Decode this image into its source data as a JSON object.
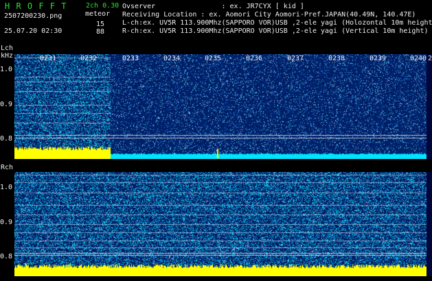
{
  "header": {
    "logo": "H R O F F T",
    "mode": "2ch 0.30",
    "file": "2507200230.png",
    "meteor_label": "meteor",
    "count_l": "15",
    "count_r": "88",
    "datetime": "25.07.20 02:30",
    "observer": "Ovserver                : ex. JR7CYX [ kid ]",
    "location": "Receiving Location : ex. Aomori City Aomori-Pref.JAPAN(40.49N, 140.47E)",
    "lch": "L-ch:ex. UV5R 113.900Mhz(SAPPORO VOR)USB ,2-ele yagi (Holozontal 10m height)",
    "rch": "R-ch:ex. UV5R 113.900Mhz(SAPPORO VOR)USB ,2-ele yagi (Vertical 10m height)"
  },
  "axis": {
    "lch_label": "Lch",
    "khz_label": "kHz",
    "rch_label": "Rch",
    "ticks": [
      "1.0",
      "0.9",
      "0.8"
    ]
  },
  "time_labels": [
    "0231",
    "0232",
    "0233",
    "0234",
    "0235",
    "0236",
    "0237",
    "0238",
    "0239",
    "0240",
    "2"
  ],
  "colors": {
    "green_text": "#2ee02e",
    "white_text": "#f0f0f0",
    "noise_bg": "#001a5e",
    "yellow_signal": "#ffff00",
    "cyan_signal": "#00e5ff"
  }
}
